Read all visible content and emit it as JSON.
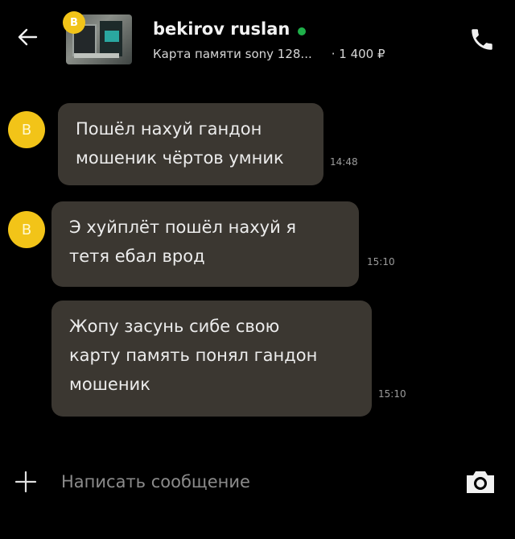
{
  "header": {
    "contact_name": "bekirov ruslan",
    "listing_title": "Карта памяти sony 128...",
    "listing_price": "· 1 400 ₽",
    "thumb_badge_letter": "B",
    "online_color": "#1fb04a"
  },
  "messages": [
    {
      "avatar_letter": "B",
      "text": "Пошёл нахуй гандон\nмошеник чёртов умник",
      "time": "14:48"
    },
    {
      "avatar_letter": "B",
      "text": "Э хуйплёт пошёл нахуй  я\nтетя ебал врод",
      "time": "15:10"
    },
    {
      "text": "Жопу засунь сибе свою\nкарту память понял гандон\nмошеник",
      "time": "15:10"
    }
  ],
  "composer": {
    "placeholder": "Написать сообщение"
  },
  "icons": {
    "back": "arrow-left-icon",
    "call": "phone-icon",
    "attach": "plus-icon",
    "camera": "camera-icon"
  },
  "colors": {
    "avatar": "#f2c418",
    "bubble": "#3b3731",
    "background": "#000000"
  }
}
